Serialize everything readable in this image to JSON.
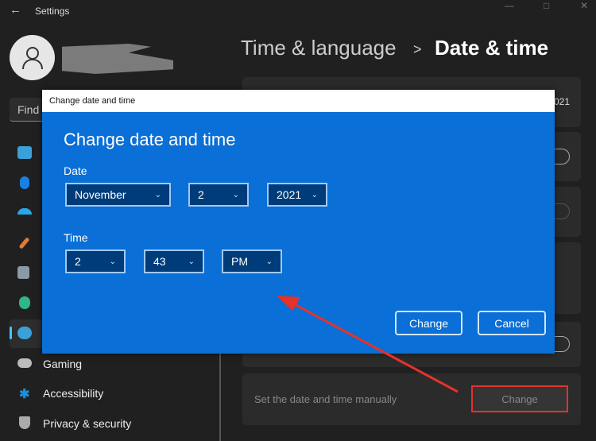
{
  "window": {
    "title": "Settings"
  },
  "sidebar": {
    "search_placeholder": "Find a",
    "items": [
      {
        "label": "",
        "icon": "system-icon",
        "color": "#3aa0d8"
      },
      {
        "label": "",
        "icon": "bluetooth-icon",
        "color": "#1a7fe0"
      },
      {
        "label": "",
        "icon": "wifi-icon",
        "color": "#2aa7e6"
      },
      {
        "label": "",
        "icon": "personalization-brush-icon",
        "color": "#e07a3a"
      },
      {
        "label": "",
        "icon": "apps-icon",
        "color": "#9aa"
      },
      {
        "label": "",
        "icon": "accounts-icon",
        "color": "#2fb68a"
      },
      {
        "label": "",
        "icon": "time-language-icon",
        "color": "#3aa0d8"
      },
      {
        "label": "Gaming",
        "icon": "gaming-icon",
        "color": "#bbb"
      },
      {
        "label": "Accessibility",
        "icon": "accessibility-icon",
        "color": "#1a8fe0"
      },
      {
        "label": "Privacy & security",
        "icon": "shield-icon",
        "color": "#aaa"
      }
    ]
  },
  "breadcrumb": {
    "parent": "Time & language",
    "separator": ">",
    "current": "Date & time"
  },
  "cards": {
    "first_value_fragment": "021",
    "manual_label": "Set the date and time manually",
    "manual_button": "Change"
  },
  "dialog": {
    "window_title": "Change date and time",
    "heading": "Change date and time",
    "date_label": "Date",
    "month": "November",
    "day": "2",
    "year": "2021",
    "time_label": "Time",
    "hour": "2",
    "minute": "43",
    "ampm": "PM",
    "change_button": "Change",
    "cancel_button": "Cancel"
  },
  "annotation_color": "#e5322b"
}
